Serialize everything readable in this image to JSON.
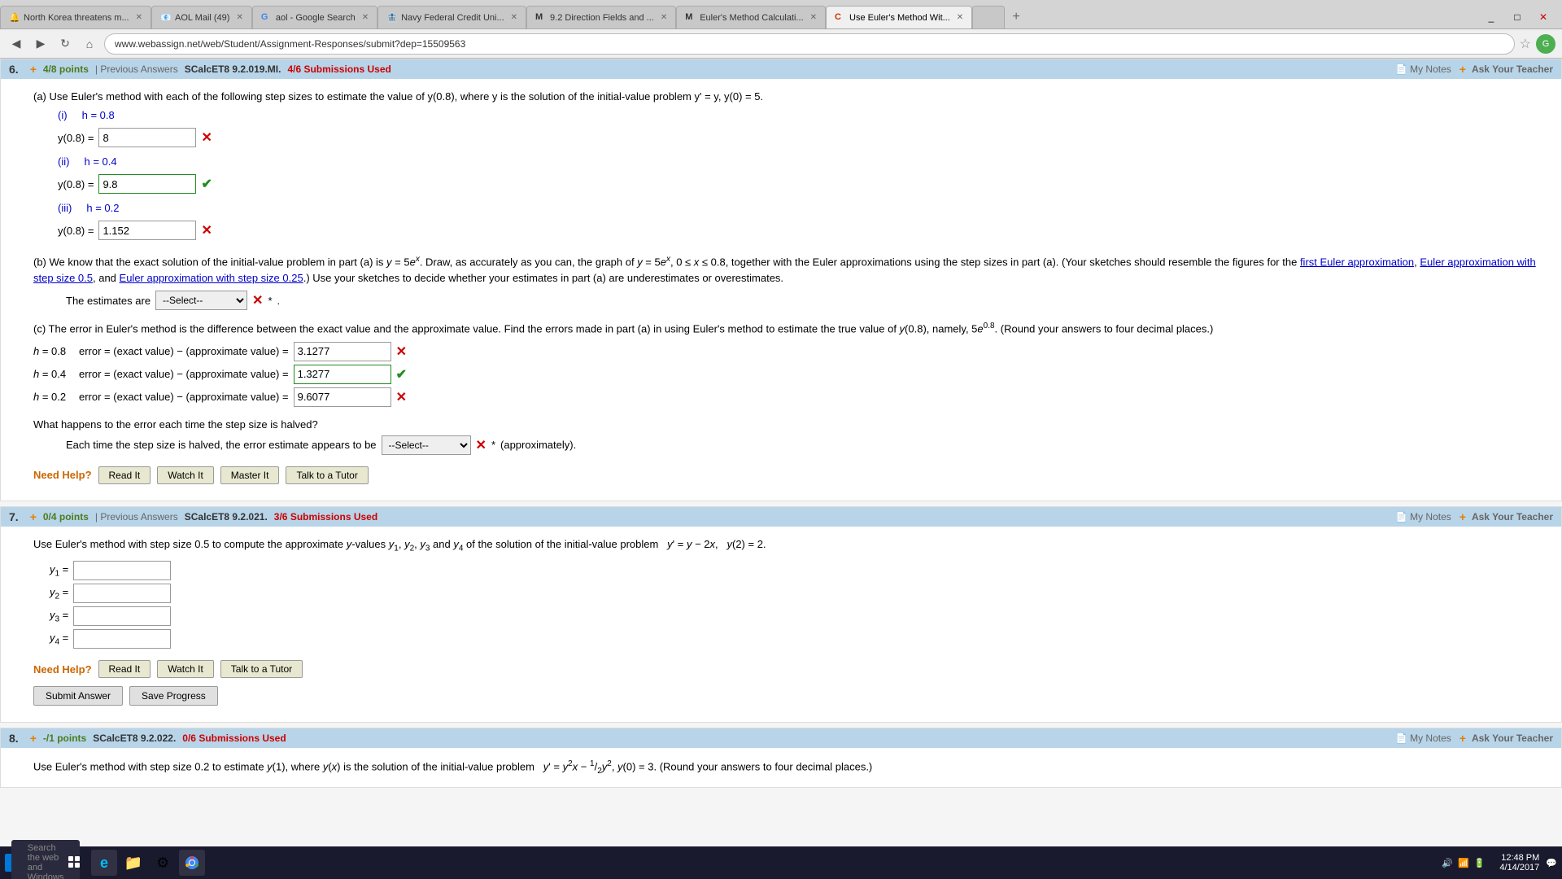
{
  "browser": {
    "tabs": [
      {
        "id": "tab1",
        "title": "North Korea threatens m...",
        "icon": "🔔",
        "active": false
      },
      {
        "id": "tab2",
        "title": "AOL Mail (49)",
        "icon": "📧",
        "active": false
      },
      {
        "id": "tab3",
        "title": "aol - Google Search",
        "icon": "G",
        "active": false
      },
      {
        "id": "tab4",
        "title": "Navy Federal Credit Uni...",
        "icon": "🏦",
        "active": false
      },
      {
        "id": "tab5",
        "title": "9.2 Direction Fields and ...",
        "icon": "M",
        "active": false
      },
      {
        "id": "tab6",
        "title": "Euler's Method Calculati...",
        "icon": "M",
        "active": false
      },
      {
        "id": "tab7",
        "title": "Use Euler's Method Wit...",
        "icon": "C",
        "active": true
      },
      {
        "id": "tab8",
        "title": "",
        "icon": "",
        "active": false
      }
    ],
    "address": "www.webassign.net/web/Student/Assignment-Responses/submit?dep=15509563"
  },
  "q6": {
    "number": "6.",
    "points": "4/8 points",
    "prev_answers": "| Previous Answers",
    "source": "SCalcET8 9.2.019.MI.",
    "submissions": "4/6 Submissions Used",
    "my_notes": "My Notes",
    "ask_teacher": "Ask Your Teacher",
    "part_a_intro": "(a) Use Euler's method with each of the following step sizes to estimate the value of y(0.8), where y is the solution of the initial-value problem y' = y, y(0) = 5.",
    "part_i_label": "(i)",
    "part_i_h": "h = 0.8",
    "part_i_eq": "y(0.8) =",
    "part_i_val": "8",
    "part_i_status": "x",
    "part_ii_label": "(ii)",
    "part_ii_h": "h = 0.4",
    "part_ii_eq": "y(0.8) =",
    "part_ii_val": "9.8",
    "part_ii_status": "check",
    "part_iii_label": "(iii)",
    "part_iii_h": "h = 0.2",
    "part_iii_eq": "y(0.8) =",
    "part_iii_val": "1.152",
    "part_iii_status": "x",
    "part_b_text1": "(b) We know that the exact solution of the initial-value problem in part (a) is y = 5e",
    "part_b_text2": ". Draw, as accurately as you can, the graph of y = 5e",
    "part_b_text3": ", 0 ≤ x ≤ 0.8, together with the Euler approximations using the step sizes in part (a). (Your sketches should resemble the figures for the",
    "part_b_link1": "first Euler approximation",
    "part_b_link2": "Euler approximation with step size 0.5",
    "part_b_link3": "Euler approximation with step size 0.25",
    "part_b_text4": ".) Use your sketches to decide whether your estimates in part (a) are underestimates or overestimates.",
    "estimates_label": "The estimates are",
    "estimates_select_placeholder": "--Select--",
    "select_dot": ".",
    "part_c_intro": "(c) The error in Euler's method is the difference between the exact value and the approximate value. Find the errors made in part (a) in using Euler's method to estimate the true value of y(0.8), namely, 5e",
    "part_c_intro2": ". (Round your answers to four decimal places.)",
    "err_h08_label": "h = 0.8",
    "err_h08_text": "error = (exact value) − (approximate value) =",
    "err_h08_val": "3.1277",
    "err_h08_status": "x",
    "err_h04_label": "h = 0.4",
    "err_h04_text": "error = (exact value) − (approximate value) =",
    "err_h04_val": "1.3277",
    "err_h04_status": "check",
    "err_h02_label": "h = 0.2",
    "err_h02_text": "error = (exact value) − (approximate value) =",
    "err_h02_val": "9.6077",
    "err_h02_status": "x",
    "what_happens": "What happens to the error each time the step size is halved?",
    "each_time_label": "Each time the step size is halved, the error estimate appears to be",
    "each_time_select": "--Select--",
    "each_time_end": "(approximately).",
    "need_help": "Need Help?",
    "btn_read_it": "Read It",
    "btn_watch_it": "Watch It",
    "btn_master_it": "Master It",
    "btn_talk_tutor": "Talk to a Tutor"
  },
  "q7": {
    "number": "7.",
    "points": "0/4 points",
    "prev_answers": "| Previous Answers",
    "source": "SCalcET8 9.2.021.",
    "submissions": "3/6 Submissions Used",
    "my_notes": "My Notes",
    "ask_teacher": "Ask Your Teacher",
    "intro": "Use Euler's method with step size 0.5 to compute the approximate y-values y₁, y₂, y₃ and y₄ of the solution of the initial-value problem  y' = y − 2x,   y(2) = 2.",
    "y1_label": "y₁ =",
    "y2_label": "y₂ =",
    "y3_label": "y₃ =",
    "y4_label": "y₄ =",
    "need_help": "Need Help?",
    "btn_read_it": "Read It",
    "btn_watch_it": "Watch It",
    "btn_talk_tutor": "Talk to a Tutor",
    "btn_submit": "Submit Answer",
    "btn_save": "Save Progress"
  },
  "q8": {
    "number": "8.",
    "points": "-/1 points",
    "source": "SCalcET8 9.2.022.",
    "submissions": "0/6 Submissions Used",
    "my_notes": "My Notes",
    "ask_teacher": "Ask Your Teacher",
    "intro": "Use Euler's method with step size 0.2 to estimate  y(1), where y(x) is the solution of the initial-value problem  y' = y²x −"
  },
  "taskbar": {
    "time": "12:48 PM",
    "date": "4/14/2017",
    "start_label": "⊞",
    "search_placeholder": "Search the web and Windows"
  }
}
